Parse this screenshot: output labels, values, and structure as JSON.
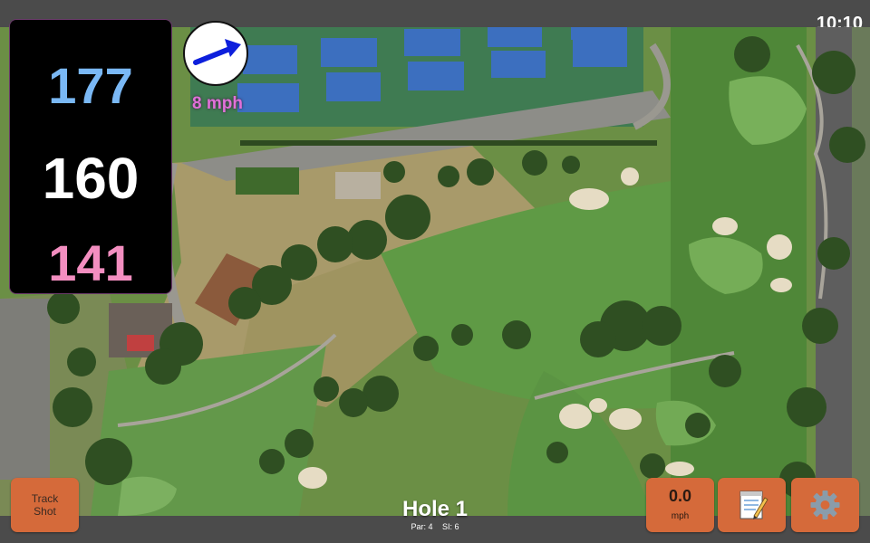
{
  "status_bar": {
    "time": "10:10"
  },
  "distances": {
    "back": "177",
    "middle": "160",
    "front": "141",
    "colors": {
      "back": "#7ab8f5",
      "middle": "#ffffff",
      "front": "#f38ec0"
    }
  },
  "wind": {
    "speed": "8 mph",
    "direction_icon": "arrow-right-up-icon"
  },
  "buttons": {
    "track_shot_line1": "Track",
    "track_shot_line2": "Shot",
    "speed_value": "0.0",
    "speed_unit": "mph",
    "notes_icon": "notepad-icon",
    "settings_icon": "gear-icon",
    "accent_color": "#d56a3a"
  },
  "hole": {
    "title": "Hole 1",
    "par": "Par: 4",
    "si": "SI: 6"
  }
}
